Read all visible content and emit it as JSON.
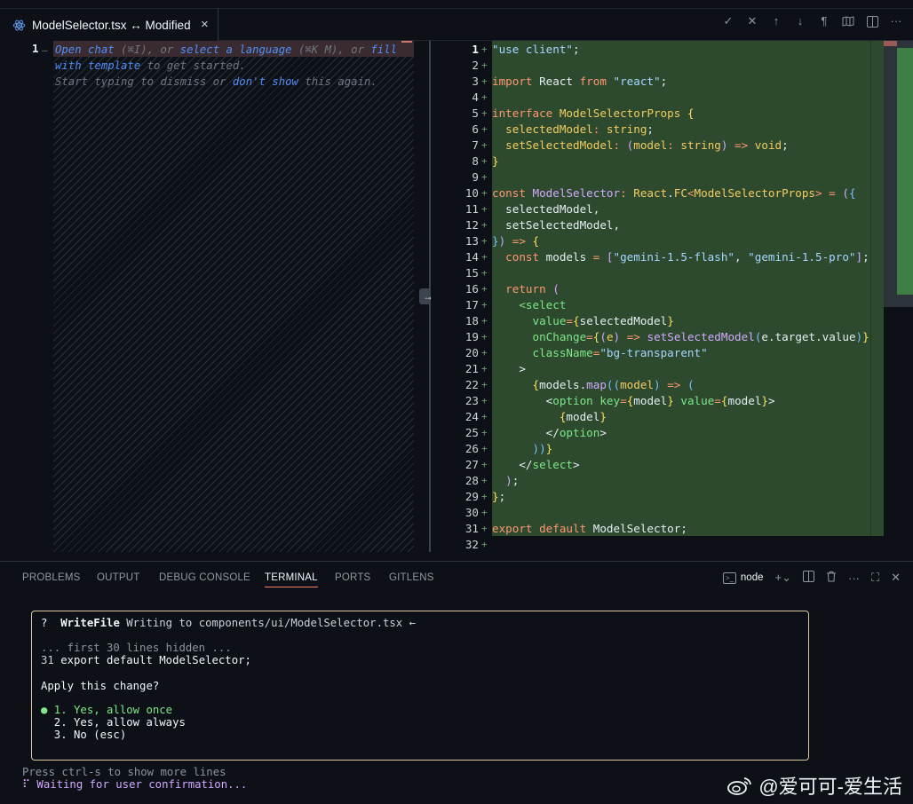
{
  "tab": {
    "title": "ModelSelector.tsx ↔ Modified",
    "close": "×"
  },
  "toolbar_icons": [
    "checkmark-icon",
    "close-icon",
    "arrow-up-icon",
    "arrow-down-icon",
    "pilcrow-icon",
    "map-icon",
    "split-editor-icon",
    "more-icon"
  ],
  "left_editor": {
    "line_number": "1",
    "hint_parts": [
      {
        "text": "Open chat",
        "link": true
      },
      {
        "text": " (⌘I), or ",
        "link": false
      },
      {
        "text": "select a language",
        "link": true
      },
      {
        "text": " (⌘K M), or ",
        "link": false
      },
      {
        "text": "fill with template",
        "link": true
      },
      {
        "text": " to get started.",
        "link": false
      },
      {
        "text": "\nStart typing to dismiss or ",
        "link": false
      },
      {
        "text": "don't show",
        "link": true
      },
      {
        "text": " this again.",
        "link": false
      }
    ]
  },
  "code_lines": [
    [
      [
        "s",
        "\"use client\""
      ],
      [
        "p",
        ";"
      ]
    ],
    [],
    [
      [
        "k",
        "import "
      ],
      [
        "p",
        "React "
      ],
      [
        "k",
        "from "
      ],
      [
        "s",
        "\"react\""
      ],
      [
        "p",
        ";"
      ]
    ],
    [],
    [
      [
        "k",
        "interface "
      ],
      [
        "t",
        "ModelSelectorProps "
      ],
      [
        "y",
        "{"
      ]
    ],
    [
      [
        "p",
        "  "
      ],
      [
        "t",
        "selectedModel"
      ],
      [
        "k",
        ": "
      ],
      [
        "t",
        "string"
      ],
      [
        "p",
        ";"
      ]
    ],
    [
      [
        "p",
        "  "
      ],
      [
        "t",
        "setSelectedModel"
      ],
      [
        "k",
        ": "
      ],
      [
        "f",
        "("
      ],
      [
        "t",
        "model"
      ],
      [
        "k",
        ": "
      ],
      [
        "t",
        "string"
      ],
      [
        "f",
        ")"
      ],
      [
        "k",
        " => "
      ],
      [
        "t",
        "void"
      ],
      [
        "p",
        ";"
      ]
    ],
    [
      [
        "y",
        "}"
      ]
    ],
    [],
    [
      [
        "k",
        "const "
      ],
      [
        "f",
        "ModelSelector"
      ],
      [
        "k",
        ": "
      ],
      [
        "t",
        "React"
      ],
      [
        "p",
        "."
      ],
      [
        "t",
        "FC"
      ],
      [
        "k",
        "<"
      ],
      [
        "t",
        "ModelSelectorProps"
      ],
      [
        "k",
        "> = "
      ],
      [
        "f",
        "("
      ],
      [
        "b",
        "{"
      ]
    ],
    [
      [
        "p",
        "  selectedModel,"
      ]
    ],
    [
      [
        "p",
        "  setSelectedModel,"
      ]
    ],
    [
      [
        "b",
        "}"
      ],
      [
        "f",
        ")"
      ],
      [
        "k",
        " => "
      ],
      [
        "y",
        "{"
      ]
    ],
    [
      [
        "p",
        "  "
      ],
      [
        "k",
        "const "
      ],
      [
        "p",
        "models "
      ],
      [
        "k",
        "= "
      ],
      [
        "f",
        "["
      ],
      [
        "s",
        "\"gemini-1.5-flash\""
      ],
      [
        "p",
        ", "
      ],
      [
        "s",
        "\"gemini-1.5-pro\""
      ],
      [
        "f",
        "]"
      ],
      [
        "p",
        ";"
      ]
    ],
    [],
    [
      [
        "p",
        "  "
      ],
      [
        "k",
        "return "
      ],
      [
        "f",
        "("
      ]
    ],
    [
      [
        "p",
        "    "
      ],
      [
        "g",
        "<select"
      ]
    ],
    [
      [
        "p",
        "      "
      ],
      [
        "g",
        "value"
      ],
      [
        "k",
        "="
      ],
      [
        "y",
        "{"
      ],
      [
        "p",
        "selectedModel"
      ],
      [
        "y",
        "}"
      ]
    ],
    [
      [
        "p",
        "      "
      ],
      [
        "g",
        "onChange"
      ],
      [
        "k",
        "="
      ],
      [
        "y",
        "{"
      ],
      [
        "f",
        "("
      ],
      [
        "t",
        "e"
      ],
      [
        "f",
        ")"
      ],
      [
        "k",
        " => "
      ],
      [
        "f",
        "setSelectedModel"
      ],
      [
        "b",
        "("
      ],
      [
        "p",
        "e.target.value"
      ],
      [
        "b",
        ")"
      ],
      [
        "y",
        "}"
      ]
    ],
    [
      [
        "p",
        "      "
      ],
      [
        "g",
        "className"
      ],
      [
        "k",
        "="
      ],
      [
        "s",
        "\"bg-transparent\""
      ]
    ],
    [
      [
        "p",
        "    "
      ],
      [
        "p",
        ">"
      ]
    ],
    [
      [
        "p",
        "      "
      ],
      [
        "y",
        "{"
      ],
      [
        "p",
        "models."
      ],
      [
        "f",
        "map"
      ],
      [
        "b",
        "(("
      ],
      [
        "t",
        "model"
      ],
      [
        "b",
        ")"
      ],
      [
        "k",
        " => "
      ],
      [
        "b",
        "("
      ]
    ],
    [
      [
        "p",
        "        "
      ],
      [
        "p",
        "<"
      ],
      [
        "g",
        "option "
      ],
      [
        "g",
        "key"
      ],
      [
        "k",
        "="
      ],
      [
        "y",
        "{"
      ],
      [
        "p",
        "model"
      ],
      [
        "y",
        "}"
      ],
      [
        "g",
        " value"
      ],
      [
        "k",
        "="
      ],
      [
        "y",
        "{"
      ],
      [
        "p",
        "model"
      ],
      [
        "y",
        "}"
      ],
      [
        "p",
        ">"
      ]
    ],
    [
      [
        "p",
        "          "
      ],
      [
        "y",
        "{"
      ],
      [
        "p",
        "model"
      ],
      [
        "y",
        "}"
      ]
    ],
    [
      [
        "p",
        "        </"
      ],
      [
        "g",
        "option"
      ],
      [
        "p",
        ">"
      ]
    ],
    [
      [
        "p",
        "      "
      ],
      [
        "b",
        "))"
      ],
      [
        "y",
        "}"
      ]
    ],
    [
      [
        "p",
        "    </"
      ],
      [
        "g",
        "select"
      ],
      [
        "p",
        ">"
      ]
    ],
    [
      [
        "p",
        "  "
      ],
      [
        "f",
        ")"
      ],
      [
        "p",
        ";"
      ]
    ],
    [
      [
        "y",
        "}"
      ],
      [
        "p",
        ";"
      ]
    ],
    [],
    [
      [
        "k",
        "export "
      ],
      [
        "k",
        "default "
      ],
      [
        "p",
        "ModelSelector;"
      ]
    ],
    []
  ],
  "panel": {
    "tabs": [
      "PROBLEMS",
      "OUTPUT",
      "DEBUG CONSOLE",
      "TERMINAL",
      "PORTS",
      "GITLENS"
    ],
    "active_tab": "TERMINAL",
    "shell": "node"
  },
  "terminal": {
    "q": "?",
    "tool": "WriteFile",
    "action": " Writing to components/ui/ModelSelector.tsx ←",
    "hidden": "... first 30 lines hidden ...",
    "line31_num": "31 ",
    "line31_code": "export default ModelSelector;",
    "question": "Apply this change?",
    "opt1": "● 1. Yes, allow once",
    "opt2": "  2. Yes, allow always",
    "opt3": "  3. No (esc)",
    "more": "Press ctrl-s to show more lines",
    "waiting_spinner": "⠏",
    "waiting": " Waiting for user confirmation..."
  },
  "watermark": "@爱可可-爱生活"
}
